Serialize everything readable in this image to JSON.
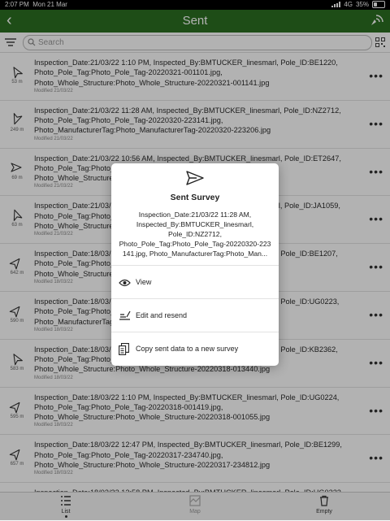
{
  "status_bar": {
    "time": "2:07 PM",
    "date": "Mon 21 Mar",
    "network": "4G",
    "battery": "35%"
  },
  "header": {
    "title": "Sent",
    "back_icon": "chevron-left-icon",
    "gps_icon": "gps-signal-icon"
  },
  "search": {
    "placeholder": "Search"
  },
  "surveys": [
    {
      "lines": [
        "Inspection_Date:21/03/22 1:10 PM, Inspected_By:BMTUCKER_linesmarl, Pole_ID:BE1220,",
        "Photo_Pole_Tag:Photo_Pole_Tag-20220321-001101.jpg,",
        "Photo_Whole_Structure:Photo_Whole_Structure-20220321-001141.jpg"
      ],
      "modified": "Modified 21/03/22",
      "distance": "53 m"
    },
    {
      "lines": [
        "Inspection_Date:21/03/22 11:28 AM, Inspected_By:BMTUCKER_linesmarl, Pole_ID:NZ2712,",
        "Photo_Pole_Tag:Photo_Pole_Tag-20220320-223141.jpg,",
        "Photo_ManufacturerTag:Photo_ManufacturerTag-20220320-223206.jpg"
      ],
      "modified": "Modified 21/03/22",
      "distance": "249 m"
    },
    {
      "lines": [
        "Inspection_Date:21/03/22 10:56 AM, Inspected_By:BMTUCKER_linesmarl, Pole_ID:ET2647,",
        "Photo_Pole_Tag:Photo_Pole_Tag-20220320-223141.jpg,",
        "Photo_Whole_Structure:Photo_Whole_Structure-20220320-223246.jpg"
      ],
      "modified": "Modified 21/03/22",
      "distance": "69 m"
    },
    {
      "lines": [
        "Inspection_Date:21/03/22 10:35 AM, Inspected_By:BMTUCKER_linesmarl, Pole_ID:JA1059,",
        "Photo_Pole_Tag:Photo_Pole_Tag-20220320-221004.jpg,",
        "Photo_Whole_Structure:Photo_Whole_Structure-20220320-221042.jpg"
      ],
      "modified": "Modified 21/03/22",
      "distance": "63 m"
    },
    {
      "lines": [
        "Inspection_Date:18/03/22 2:40 PM, Inspected_By:BMTUCKER_linesmarl, Pole_ID:BE1207,",
        "Photo_Pole_Tag:Photo_Pole_Tag-20220318-023951.jpg,",
        "Photo_Whole_Structure:Photo_Whole_Structure-20220318-024016.jpg"
      ],
      "modified": "Modified 18/03/22",
      "distance": "642 m"
    },
    {
      "lines": [
        "Inspection_Date:18/03/22 2:05 PM, Inspected_By:BMTUCKER_linesmarl, Pole_ID:UG0223,",
        "Photo_Pole_Tag:Photo_Pole_Tag-20220318-020455.jpg,",
        "Photo_ManufacturerTag:Photo_ManufacturerTag-20220318-020521.jpg"
      ],
      "modified": "Modified 18/03/22",
      "distance": "590 m"
    },
    {
      "lines": [
        "Inspection_Date:18/03/22 1:35 PM, Inspected_By:BMTUCKER_linesmarl, Pole_ID:KB2362,",
        "Photo_Pole_Tag:Photo_Pole_Tag-20220318-013411.jpg,",
        "Photo_Whole_Structure:Photo_Whole_Structure-20220318-013440.jpg"
      ],
      "modified": "Modified 18/03/22",
      "distance": "583 m"
    },
    {
      "lines": [
        "Inspection_Date:18/03/22 1:10 PM, Inspected_By:BMTUCKER_linesmarl, Pole_ID:UG0224,",
        "Photo_Pole_Tag:Photo_Pole_Tag-20220318-001419.jpg,",
        "Photo_Whole_Structure:Photo_Whole_Structure-20220318-001055.jpg"
      ],
      "modified": "Modified 18/03/22",
      "distance": "595 m"
    },
    {
      "lines": [
        "Inspection_Date:18/03/22 12:47 PM, Inspected_By:BMTUCKER_linesmarl, Pole_ID:BE1299,",
        "Photo_Pole_Tag:Photo_Pole_Tag-20220317-234740.jpg,",
        "Photo_Whole_Structure:Photo_Whole_Structure-20220317-234812.jpg"
      ],
      "modified": "Modified 18/03/22",
      "distance": "657 m"
    },
    {
      "lines": [
        "Inspection_Date:18/03/22 12:58 PM, Inspected_By:BMTUCKER_linesmarl, Pole_ID:UG0222,",
        "",
        ""
      ],
      "modified": "",
      "distance": ""
    }
  ],
  "tabs": {
    "list": "List",
    "map": "Map",
    "empty": "Empty"
  },
  "modal": {
    "title": "Sent Survey",
    "description_lines": [
      "Inspection_Date:21/03/22 11:28 AM,",
      "Inspected_By:BMTUCKER_linesmarl,",
      "Pole_ID:NZ2712,",
      "Photo_Pole_Tag:Photo_Pole_Tag-20220320-223",
      "141.jpg, Photo_ManufacturerTag:Photo_Man..."
    ],
    "options": [
      {
        "label": "View",
        "icon": "eye-icon"
      },
      {
        "label": "Edit and resend",
        "icon": "edit-icon"
      },
      {
        "label": "Copy sent data to a new survey",
        "icon": "copy-icon"
      }
    ]
  },
  "colors": {
    "header_green": "#2c6f21"
  }
}
